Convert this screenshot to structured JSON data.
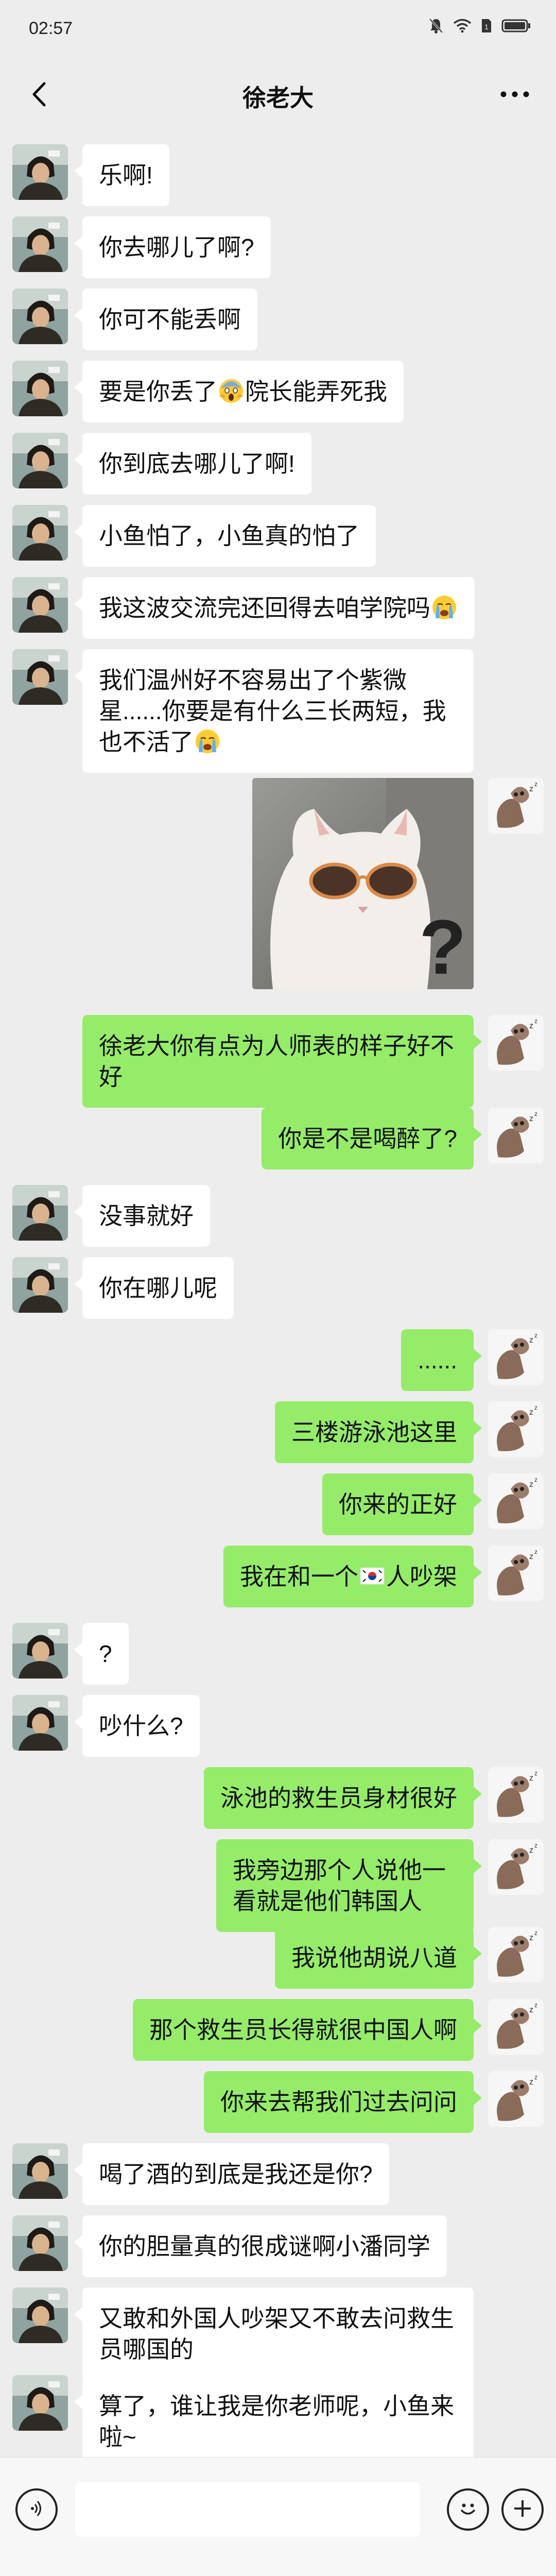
{
  "status_bar": {
    "time": "02:57",
    "icons": [
      "mute-bell-icon",
      "wifi-icon",
      "sim-icon",
      "battery-icon"
    ]
  },
  "nav": {
    "title": "徐老大",
    "back_icon": "chevron-left-icon",
    "more_icon": "more-dots-icon"
  },
  "colors": {
    "background": "#EDEDED",
    "my_bubble": "#95EC69",
    "their_bubble": "#FFFFFF"
  },
  "messages": [
    {
      "side": "left",
      "text": "乐啊!"
    },
    {
      "side": "left",
      "text": "你去哪儿了啊?"
    },
    {
      "side": "left",
      "text": "你可不能丢啊"
    },
    {
      "side": "left",
      "text_before": "要是你丢了",
      "emoji": "scream-emoji",
      "text_after": "院长能弄死我"
    },
    {
      "side": "left",
      "text": "你到底去哪儿了啊!"
    },
    {
      "side": "left",
      "text": "小鱼怕了，小鱼真的怕了"
    },
    {
      "side": "left",
      "text_before": "我这波交流完还回得去咱学院吗",
      "emoji": "crying-emoji",
      "text_after": ""
    },
    {
      "side": "left",
      "text_before": "我们温州好不容易出了个紫微星......你要是有什么三长两短，我也不活了",
      "emoji": "crying-emoji",
      "text_after": ""
    },
    {
      "side": "right",
      "type": "sticker",
      "sticker": "cat-sunglasses-sticker"
    },
    {
      "side": "right",
      "text": "徐老大你有点为人师表的样子好不好"
    },
    {
      "side": "right",
      "text": "你是不是喝醉了?"
    },
    {
      "side": "left",
      "text": "没事就好"
    },
    {
      "side": "left",
      "text": "你在哪儿呢"
    },
    {
      "side": "right",
      "text": "......"
    },
    {
      "side": "right",
      "text": "三楼游泳池这里"
    },
    {
      "side": "right",
      "text": "你来的正好"
    },
    {
      "side": "right",
      "text_before": "我在和一个",
      "emoji": "korea-flag-emoji",
      "text_after": "人吵架"
    },
    {
      "side": "left",
      "text": "?"
    },
    {
      "side": "left",
      "text": "吵什么?"
    },
    {
      "side": "right",
      "text": "泳池的救生员身材很好"
    },
    {
      "side": "right",
      "text": "我旁边那个人说他一看就是他们韩国人"
    },
    {
      "side": "right",
      "text": "我说他胡说八道"
    },
    {
      "side": "right",
      "text": "那个救生员长得就很中国人啊"
    },
    {
      "side": "right",
      "text": "你来去帮我们过去问问"
    },
    {
      "side": "left",
      "text": "喝了酒的到底是我还是你?"
    },
    {
      "side": "left",
      "text": "你的胆量真的很成谜啊小潘同学"
    },
    {
      "side": "left",
      "text": "又敢和外国人吵架又不敢去问救生员哪国的"
    },
    {
      "side": "left",
      "text": "算了，谁让我是你老师呢，小鱼来啦~"
    }
  ],
  "input_bar": {
    "voice_icon": "voice-icon",
    "emoji_icon": "emoji-face-icon",
    "plus_icon": "plus-icon",
    "value": ""
  }
}
